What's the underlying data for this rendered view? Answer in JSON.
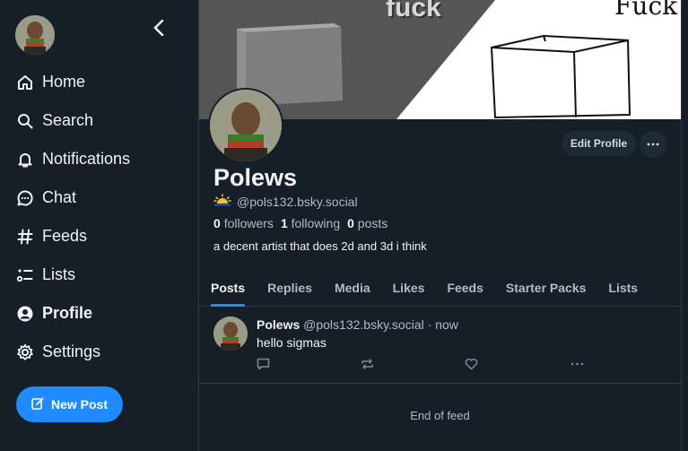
{
  "nav": {
    "items": [
      {
        "label": "Home",
        "icon": "home-icon"
      },
      {
        "label": "Search",
        "icon": "search-icon"
      },
      {
        "label": "Notifications",
        "icon": "bell-icon"
      },
      {
        "label": "Chat",
        "icon": "chat-icon"
      },
      {
        "label": "Feeds",
        "icon": "hash-icon"
      },
      {
        "label": "Lists",
        "icon": "list-icon"
      },
      {
        "label": "Profile",
        "icon": "profile-icon"
      },
      {
        "label": "Settings",
        "icon": "gear-icon"
      }
    ],
    "new_post_label": "New Post"
  },
  "banner": {
    "text_left": "fuck",
    "text_right": "Fuck"
  },
  "profile": {
    "display_name": "Polews",
    "handle": "@pols132.bsky.social",
    "followers_count": "0",
    "followers_label": "followers",
    "following_count": "1",
    "following_label": "following",
    "posts_count": "0",
    "posts_label": "posts",
    "bio": "a decent artist that does 2d and 3d i think",
    "edit_label": "Edit Profile"
  },
  "tabs": [
    "Posts",
    "Replies",
    "Media",
    "Likes",
    "Feeds",
    "Starter Packs",
    "Lists"
  ],
  "post": {
    "author": "Polews",
    "meta": "@pols132.bsky.social · now",
    "text": "hello sigmas"
  },
  "end_of_feed": "End of feed",
  "colors": {
    "accent": "#208bfe",
    "background": "#161e27"
  }
}
